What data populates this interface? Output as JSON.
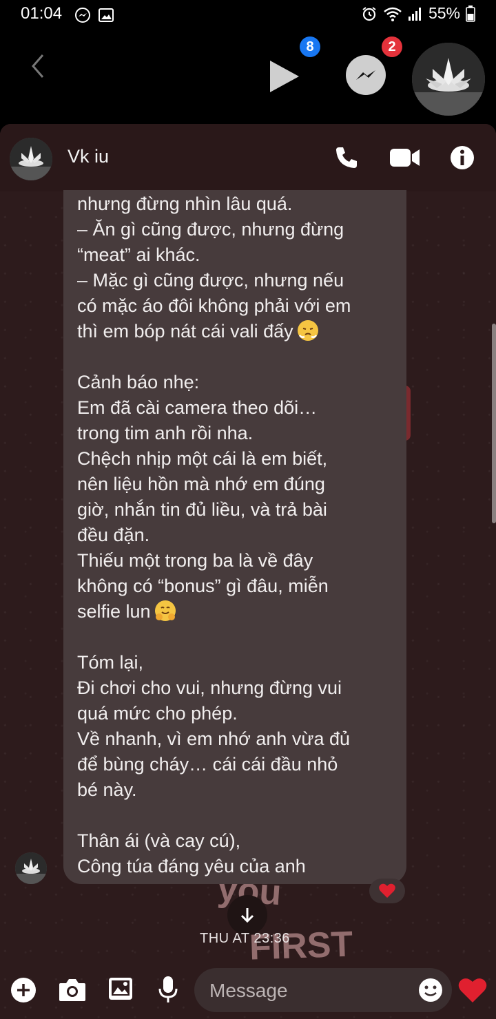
{
  "status_bar": {
    "time": "01:04",
    "battery": "55%"
  },
  "chat_heads": {
    "video_badge": "8",
    "messenger_badge": "2"
  },
  "header": {
    "contact_name": "Vk iu"
  },
  "message": {
    "lines": [
      "nhưng đừng nhìn lâu quá.",
      "– Ăn gì cũng được, nhưng đừng",
      "“meat” ai khác.",
      "– Mặc gì cũng được, nhưng nếu",
      "có mặc áo đôi không phải với em",
      "thì em bóp nát cái vali đấy",
      "",
      "Cảnh báo nhẹ:",
      "Em đã cài camera theo dõi…",
      "trong tim anh rồi nha.",
      "Chệch nhịp một cái là em biết,",
      "nên liệu hồn mà nhớ em đúng",
      "giờ, nhắn tin đủ liều, và trả bài",
      "đều đặn.",
      "Thiếu một trong ba là về đây",
      "không có “bonus” gì đâu, miễn",
      "selfie lun",
      "",
      "Tóm lại,",
      "Đi chơi cho vui, nhưng đừng vui",
      "quá mức cho phép.",
      "Về nhanh, vì em nhớ anh vừa đủ",
      "để bùng cháy… cái cái đầu nhỏ",
      "bé này.",
      "",
      "Thân ái (và cay cú),",
      "Công túa đáng yêu của anh"
    ],
    "emoji_1": "steam-from-nose-emoji",
    "emoji_2": "hugging-face-emoji",
    "reaction": "heart"
  },
  "timestamp": "THU AT 23:36",
  "composer": {
    "placeholder": "Message"
  },
  "colors": {
    "panel_bg": "#2d1b1c",
    "bubble_bg": "#473b3c",
    "badge_blue": "#1877f2",
    "badge_red": "#e4323b",
    "heart_red": "#e0202f"
  }
}
